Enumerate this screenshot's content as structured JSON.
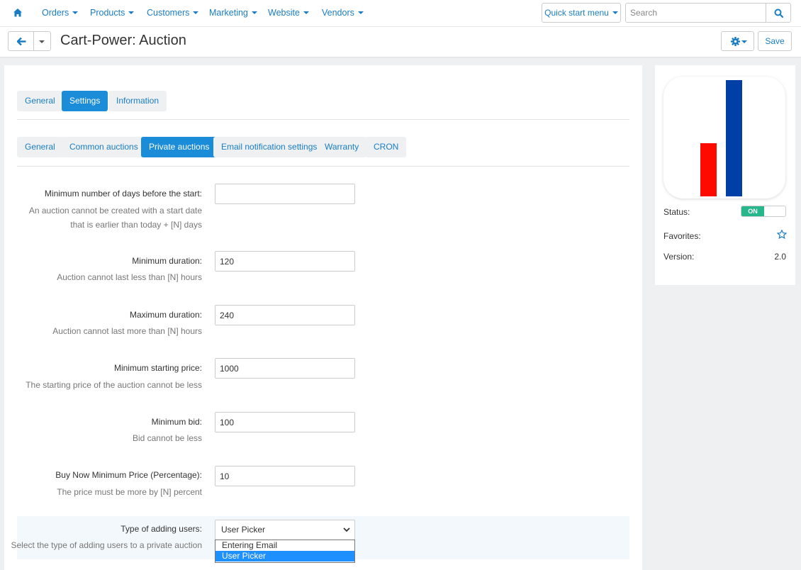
{
  "nav": {
    "items": [
      {
        "label": "Orders"
      },
      {
        "label": "Products"
      },
      {
        "label": "Customers"
      },
      {
        "label": "Marketing"
      },
      {
        "label": "Website"
      },
      {
        "label": "Vendors"
      }
    ],
    "quick_start_label": "Quick start menu",
    "search_placeholder": "Search"
  },
  "header": {
    "title": "Cart-Power: Auction",
    "save_label": "Save"
  },
  "tabs": [
    {
      "label": "General",
      "active": false
    },
    {
      "label": "Settings",
      "active": true
    },
    {
      "label": "Information",
      "active": false
    }
  ],
  "subtabs": [
    {
      "label": "General",
      "active": false
    },
    {
      "label": "Common auctions",
      "active": false
    },
    {
      "label": "Private auctions",
      "active": true
    },
    {
      "label": "Email notification settings",
      "active": false
    },
    {
      "label": "Warranty",
      "active": false
    },
    {
      "label": "CRON",
      "active": false
    }
  ],
  "fields": [
    {
      "label": "Minimum number of days before the start:",
      "help": "An auction cannot be created with a start date that is earlier than today + [N] days",
      "value": ""
    },
    {
      "label": "Minimum duration:",
      "help": "Auction cannot last less than [N] hours",
      "value": "120"
    },
    {
      "label": "Maximum duration:",
      "help": "Auction cannot last more than [N] hours",
      "value": "240"
    },
    {
      "label": "Minimum starting price:",
      "help": "The starting price of the auction cannot be less",
      "value": "1000"
    },
    {
      "label": "Minimum bid:",
      "help": "Bid cannot be less",
      "value": "100"
    },
    {
      "label": "Buy Now Minimum Price (Percentage):",
      "help": "The price must be more by [N] percent",
      "value": "10"
    }
  ],
  "user_type": {
    "label": "Type of adding users:",
    "help": "Select the type of adding users to a private auction",
    "selected": "User Picker",
    "options": [
      "Entering Email",
      "User Picker"
    ]
  },
  "sidebar": {
    "status_label": "Status:",
    "status_value": "ON",
    "favorites_label": "Favorites:",
    "version_label": "Version:",
    "version_value": "2.0"
  },
  "colors": {
    "accent": "#1a8cd8",
    "link": "#1a7dc4",
    "toggle_on": "#28b78d",
    "icon_red_bar": "#ff0a00",
    "icon_blue_bar": "#003fa5"
  },
  "icons": [
    "home-icon",
    "search-icon",
    "arrow-left-icon",
    "gear-icon",
    "star-icon",
    "chevron-down-icon"
  ]
}
